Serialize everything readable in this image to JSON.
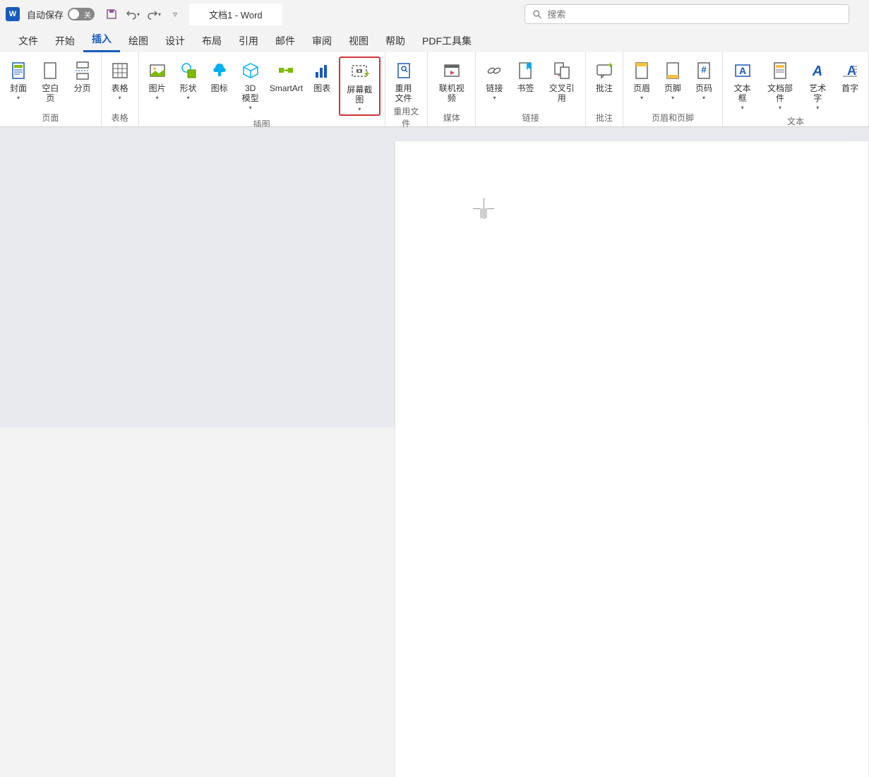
{
  "titlebar": {
    "autosave_label": "自动保存",
    "toggle_state": "关",
    "doc_title": "文档1  -  Word"
  },
  "search": {
    "placeholder": "搜索"
  },
  "tabs": {
    "items": [
      {
        "label": "文件"
      },
      {
        "label": "开始"
      },
      {
        "label": "插入"
      },
      {
        "label": "绘图"
      },
      {
        "label": "设计"
      },
      {
        "label": "布局"
      },
      {
        "label": "引用"
      },
      {
        "label": "邮件"
      },
      {
        "label": "审阅"
      },
      {
        "label": "视图"
      },
      {
        "label": "帮助"
      },
      {
        "label": "PDF工具集"
      }
    ],
    "active_index": 2
  },
  "ribbon": {
    "groups": [
      {
        "label": "页面",
        "items": [
          {
            "label": "封面",
            "icon": "cover-page",
            "dropdown": true
          },
          {
            "label": "空白页",
            "icon": "blank-page"
          },
          {
            "label": "分页",
            "icon": "page-break"
          }
        ]
      },
      {
        "label": "表格",
        "items": [
          {
            "label": "表格",
            "icon": "table",
            "dropdown": true
          }
        ]
      },
      {
        "label": "插图",
        "items": [
          {
            "label": "图片",
            "icon": "pictures",
            "dropdown": true
          },
          {
            "label": "形状",
            "icon": "shapes",
            "dropdown": true
          },
          {
            "label": "图标",
            "icon": "icons"
          },
          {
            "label": "3D 模型",
            "icon": "3d-models",
            "dropdown": true,
            "split_label": true
          },
          {
            "label": "SmartArt",
            "icon": "smartart"
          },
          {
            "label": "图表",
            "icon": "chart"
          },
          {
            "label": "屏幕截图",
            "icon": "screenshot",
            "dropdown": true,
            "highlighted": true
          }
        ]
      },
      {
        "label": "重用文件",
        "items": [
          {
            "label": "重用文件",
            "icon": "reuse-files",
            "split_label": true
          }
        ]
      },
      {
        "label": "媒体",
        "items": [
          {
            "label": "联机视频",
            "icon": "online-video"
          }
        ]
      },
      {
        "label": "链接",
        "items": [
          {
            "label": "链接",
            "icon": "link",
            "dropdown": true
          },
          {
            "label": "书签",
            "icon": "bookmark"
          },
          {
            "label": "交叉引用",
            "icon": "cross-reference"
          }
        ]
      },
      {
        "label": "批注",
        "items": [
          {
            "label": "批注",
            "icon": "comment"
          }
        ]
      },
      {
        "label": "页眉和页脚",
        "items": [
          {
            "label": "页眉",
            "icon": "header",
            "dropdown": true
          },
          {
            "label": "页脚",
            "icon": "footer",
            "dropdown": true
          },
          {
            "label": "页码",
            "icon": "page-number",
            "dropdown": true
          }
        ]
      },
      {
        "label": "文本",
        "items": [
          {
            "label": "文本框",
            "icon": "text-box",
            "dropdown": true
          },
          {
            "label": "文档部件",
            "icon": "quick-parts",
            "dropdown": true
          },
          {
            "label": "艺术字",
            "icon": "wordart",
            "dropdown": true
          },
          {
            "label": "首字",
            "icon": "drop-cap",
            "partial": true
          }
        ]
      }
    ]
  },
  "icons": {
    "cover-page": "<svg width='28' height='28' viewBox='0 0 28 28'><rect x='6' y='3' width='16' height='22' fill='none' stroke='#185abd' stroke-width='1.5'/><rect x='8' y='6' width='12' height='4' fill='#7fba00'/><line x1='8' y1='13' x2='20' y2='13' stroke='#185abd'/><line x1='8' y1='16' x2='20' y2='16' stroke='#185abd'/><line x1='8' y1='19' x2='16' y2='19' stroke='#185abd'/></svg>",
    "blank-page": "<svg width='28' height='28' viewBox='0 0 28 28'><rect x='6' y='3' width='16' height='22' fill='none' stroke='#666' stroke-width='1.5'/></svg>",
    "page-break": "<svg width='28' height='28' viewBox='0 0 28 28'><rect x='6' y='2' width='16' height='8' fill='none' stroke='#666' stroke-width='1.5'/><line x1='4' y1='14' x2='24' y2='14' stroke='#185abd' stroke-dasharray='2,2'/><rect x='6' y='18' width='16' height='8' fill='none' stroke='#666' stroke-width='1.5'/></svg>",
    "table": "<svg width='28' height='28' viewBox='0 0 28 28'><rect x='4' y='4' width='20' height='20' fill='none' stroke='#666' stroke-width='1.5'/><line x1='4' y1='11' x2='24' y2='11' stroke='#666'/><line x1='4' y1='17' x2='24' y2='17' stroke='#666'/><line x1='11' y1='4' x2='11' y2='24' stroke='#666'/><line x1='17' y1='4' x2='17' y2='24' stroke='#666'/></svg>",
    "pictures": "<svg width='28' height='28' viewBox='0 0 28 28'><rect x='4' y='6' width='20' height='16' fill='none' stroke='#666' stroke-width='1.5'/><circle cx='10' cy='11' r='2' fill='#f5c142'/><polyline points='4,20 11,14 16,18 24,12 24,22 4,22' fill='#7fba00'/></svg>",
    "shapes": "<svg width='28' height='28' viewBox='0 0 28 28'><circle cx='11' cy='10' r='6' fill='none' stroke='#00b0f0' stroke-width='1.5'/><rect x='13' y='13' width='11' height='11' fill='#7fba00' stroke='#5a8a00' stroke-width='1'/></svg>",
    "icons": "<svg width='28' height='28' viewBox='0 0 28 28'><path d='M14 4 C10 4 8 7 8 10 C5 10 4 16 8 16 L12 16 L12 22 L16 22 L16 16 L20 16 C24 16 23 10 20 10 C20 7 18 4 14 4' fill='#00b0f0'/></svg>",
    "3d-models": "<svg width='28' height='28' viewBox='0 0 28 28'><path d='M14 4 L24 9 L24 19 L14 24 L4 19 L4 9 Z' fill='none' stroke='#00b0f0' stroke-width='1.5'/><path d='M4 9 L14 14 L24 9 M14 14 L14 24' fill='none' stroke='#00b0f0' stroke-width='1.5'/></svg>",
    "smartart": "<svg width='28' height='28' viewBox='0 0 28 28'><rect x='4' y='10' width='7' height='7' fill='#7fba00'/><rect x='17' y='10' width='7' height='7' fill='#7fba00'/><path d='M11 13.5 L17 13.5' stroke='#7fba00' stroke-width='2' marker-end='url(#a)'/><polygon points='15,11 18,13.5 15,16' fill='#7fba00'/></svg>",
    "chart": "<svg width='28' height='28' viewBox='0 0 28 28'><rect x='5' y='16' width='4' height='8' fill='#185abd'/><rect x='11' y='10' width='4' height='14' fill='#185abd'/><rect x='17' y='6' width='4' height='18' fill='#185abd'/></svg>",
    "screenshot": "<svg width='28' height='28' viewBox='0 0 28 28'><rect x='4' y='5' width='20' height='15' fill='none' stroke='#666' stroke-width='1.5' stroke-dasharray='3,2'/><rect x='10' y='10' width='8' height='5' fill='#666'/><circle cx='14' cy='12.5' r='1.5' fill='white'/><text x='21' y='21' font-size='14' fill='#7fba00' font-weight='bold'>+</text></svg>",
    "reuse-files": "<svg width='28' height='28' viewBox='0 0 28 28'><rect x='6' y='4' width='16' height='20' fill='none' stroke='#185abd' stroke-width='1.5'/><circle cx='14' cy='11' r='3' fill='none' stroke='#185abd' stroke-width='1.5'/><line x1='16' y1='13' x2='19' y2='16' stroke='#185abd' stroke-width='1.5'/></svg>",
    "online-video": "<svg width='28' height='28' viewBox='0 0 28 28'><rect x='4' y='6' width='20' height='16' fill='none' stroke='#666' stroke-width='1.5'/><rect x='4' y='6' width='20' height='4' fill='#666'/><polygon points='12,14 12,20 18,17' fill='#e74856'/></svg>",
    "link": "<svg width='28' height='28' viewBox='0 0 28 28'><ellipse cx='10' cy='14' rx='5' ry='3' fill='none' stroke='#666' stroke-width='1.5' transform='rotate(-30 10 14)'/><ellipse cx='18' cy='14' rx='5' ry='3' fill='none' stroke='#666' stroke-width='1.5' transform='rotate(-30 18 14)'/></svg>",
    "bookmark": "<svg width='28' height='28' viewBox='0 0 28 28'><rect x='6' y='3' width='16' height='22' fill='none' stroke='#666' stroke-width='1.5'/><path d='M16 3 L16 13 L19 10 L22 13 L22 3' fill='#00b0f0'/></svg>",
    "cross-reference": "<svg width='28' height='28' viewBox='0 0 28 28'><rect x='4' y='3' width='12' height='16' fill='none' stroke='#666' stroke-width='1.5'/><rect x='12' y='9' width='12' height='16' fill='white' stroke='#666' stroke-width='1.5'/><text x='8' y='24' font-size='12' fill='#e74856' font-weight='bold'>-</text></svg>",
    "comment": "<svg width='28' height='28' viewBox='0 0 28 28'><rect x='4' y='6' width='20' height='14' rx='2' fill='none' stroke='#666' stroke-width='1.5'/><path d='M10 20 L10 24 L14 20' fill='none' stroke='#666' stroke-width='1.5'/><text x='19' y='10' font-size='12' fill='#7fba00' font-weight='bold'>+</text></svg>",
    "header": "<svg width='28' height='28' viewBox='0 0 28 28'><rect x='6' y='3' width='16' height='22' fill='none' stroke='#666' stroke-width='1.5'/><rect x='6' y='3' width='16' height='5' fill='#f5c142'/></svg>",
    "footer": "<svg width='28' height='28' viewBox='0 0 28 28'><rect x='6' y='3' width='16' height='22' fill='none' stroke='#666' stroke-width='1.5'/><rect x='6' y='20' width='16' height='5' fill='#f5c142'/></svg>",
    "page-number": "<svg width='28' height='28' viewBox='0 0 28 28'><rect x='6' y='3' width='16' height='22' fill='none' stroke='#666' stroke-width='1.5'/><text x='14' y='17' font-size='13' fill='#185abd' text-anchor='middle' font-weight='bold'>#</text></svg>",
    "text-box": "<svg width='28' height='28' viewBox='0 0 28 28'><rect x='4' y='6' width='20' height='16' fill='none' stroke='#185abd' stroke-width='1.5'/><text x='14' y='19' font-size='14' fill='#185abd' text-anchor='middle' font-weight='bold'>A</text></svg>",
    "quick-parts": "<svg width='28' height='28' viewBox='0 0 28 28'><rect x='6' y='3' width='16' height='22' fill='none' stroke='#666' stroke-width='1.5'/><rect x='8' y='6' width='12' height='4' fill='#f5c142'/><line x1='8' y1='13' x2='20' y2='13' stroke='#666'/><line x1='8' y1='16' x2='20' y2='16' stroke='#666'/></svg>",
    "wordart": "<svg width='28' height='28' viewBox='0 0 28 28'><text x='14' y='21' font-size='20' fill='#185abd' text-anchor='middle' font-weight='bold' font-style='italic'>A</text></svg>",
    "drop-cap": "<svg width='28' height='28' viewBox='0 0 28 28'><text x='10' y='20' font-size='18' fill='#185abd' font-weight='bold'>A</text><line x1='18' y1='8' x2='24' y2='8' stroke='#666'/><line x1='18' y1='12' x2='24' y2='12' stroke='#666'/><line x1='18' y1='16' x2='24' y2='16' stroke='#666'/><line x1='4' y1='22' x2='24' y2='22' stroke='#666'/></svg>"
  }
}
